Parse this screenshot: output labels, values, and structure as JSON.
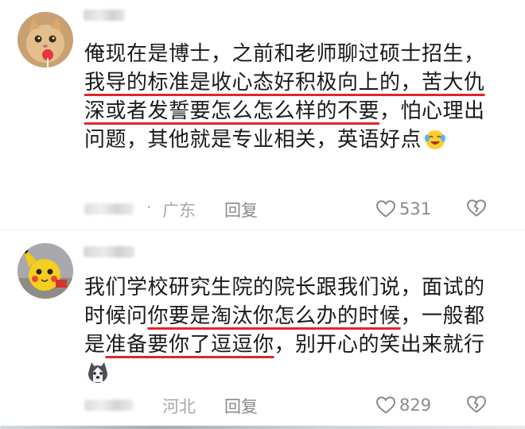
{
  "comments": [
    {
      "avatar_icon": "cat-avatar-icon",
      "body_parts": [
        "俺现在是博士，之前和老师聊过硕士招生，",
        "我导的标准是收心态好积极向上的，苦大仇深或者发誓要怎么怎么样的不要",
        "，怕心理出问题，其他就是专业相关，英语好点"
      ],
      "emoji_icon": "laughing-tears-emoji-icon",
      "location": "广东",
      "reply_label": "回复",
      "like_count": "531"
    },
    {
      "avatar_icon": "pikachu-avatar-icon",
      "body_parts": [
        "我们学校研究生院的院长跟我们说，面试的时候问",
        "你要是淘汰你怎么办的时候",
        "，一般都是",
        "准备要你了逗逗你",
        "，别开心的笑出来就行"
      ],
      "emoji_icon": "husky-dog-emoji-icon",
      "location": "河北",
      "reply_label": "回复",
      "like_count": "829"
    }
  ],
  "colors": {
    "highlight_underline": "#e0262b",
    "text": "#1a1a1a",
    "meta": "#a8a8a8"
  }
}
